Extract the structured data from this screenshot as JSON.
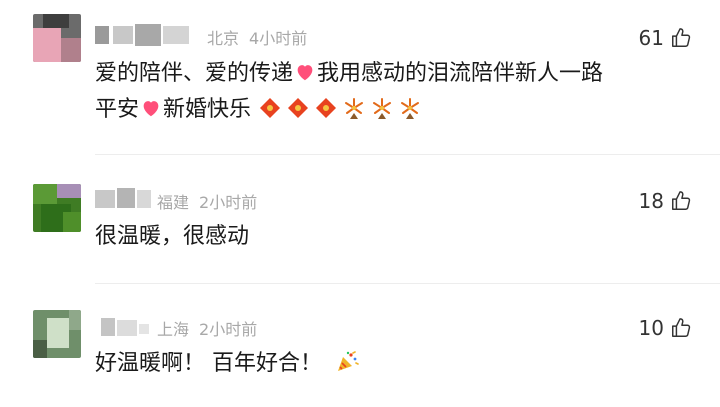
{
  "comments": [
    {
      "location": "北京",
      "time": "4小时前",
      "likes": "61",
      "line1": "爱的陪伴、爱的传递",
      "line1b": "我用感动的泪流陪伴新人一路",
      "line2": "平安",
      "line2b": "新婚快乐",
      "emojis": [
        "red-diamond-emoji",
        "red-diamond-emoji",
        "red-diamond-emoji",
        "fireworks-emoji",
        "fireworks-emoji",
        "fireworks-emoji"
      ],
      "avatar_colors": [
        "#e8a5b6",
        "#5a5a5a",
        "#b0808c"
      ]
    },
    {
      "location": "福建",
      "time": "2小时前",
      "likes": "18",
      "text": "很温暖，很感动",
      "avatar_colors": [
        "#4a8f2a",
        "#2e6e1a",
        "#a78fb6"
      ]
    },
    {
      "location": "上海",
      "time": "2小时前",
      "likes": "10",
      "text": "好温暖啊！ 百年好合！",
      "emoji": "party-popper-emoji",
      "avatar_colors": [
        "#7fa07a",
        "#cfe0c8",
        "#4a5f45"
      ]
    }
  ],
  "colors": {
    "text": "#1a1a1a",
    "meta": "#a8a8a8",
    "heart": "#ff4f7a",
    "divider": "#ededed"
  }
}
